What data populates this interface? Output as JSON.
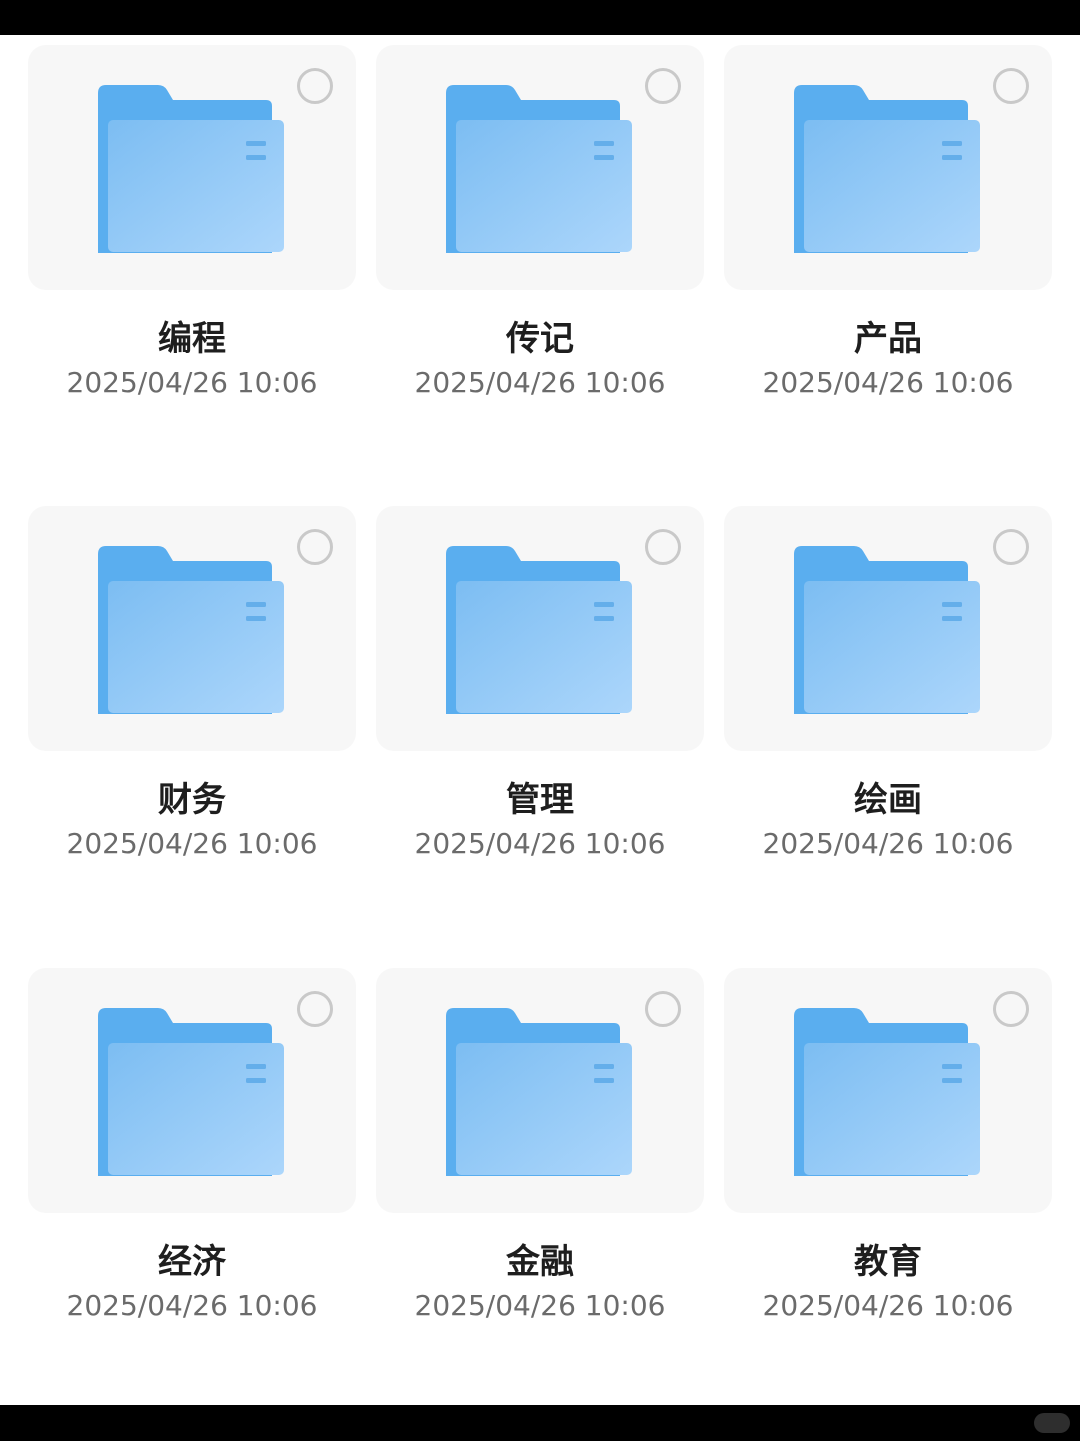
{
  "colors": {
    "folder_back": "#5aaeef",
    "folder_front_start": "#7cbdf2",
    "folder_front_end": "#acd6fb",
    "folder_lines": "#64aeea",
    "card_bg": "#f7f7f7",
    "select_ring": "#c9c9c9"
  },
  "folders": [
    {
      "name": "编程",
      "date": "2025/04/26 10:06",
      "icon": "folder-icon",
      "selected": false
    },
    {
      "name": "传记",
      "date": "2025/04/26 10:06",
      "icon": "folder-icon",
      "selected": false
    },
    {
      "name": "产品",
      "date": "2025/04/26 10:06",
      "icon": "folder-icon",
      "selected": false
    },
    {
      "name": "财务",
      "date": "2025/04/26 10:06",
      "icon": "folder-icon",
      "selected": false
    },
    {
      "name": "管理",
      "date": "2025/04/26 10:06",
      "icon": "folder-icon",
      "selected": false
    },
    {
      "name": "绘画",
      "date": "2025/04/26 10:06",
      "icon": "folder-icon",
      "selected": false
    },
    {
      "name": "经济",
      "date": "2025/04/26 10:06",
      "icon": "folder-icon",
      "selected": false
    },
    {
      "name": "金融",
      "date": "2025/04/26 10:06",
      "icon": "folder-icon",
      "selected": false
    },
    {
      "name": "教育",
      "date": "2025/04/26 10:06",
      "icon": "folder-icon",
      "selected": false
    }
  ]
}
